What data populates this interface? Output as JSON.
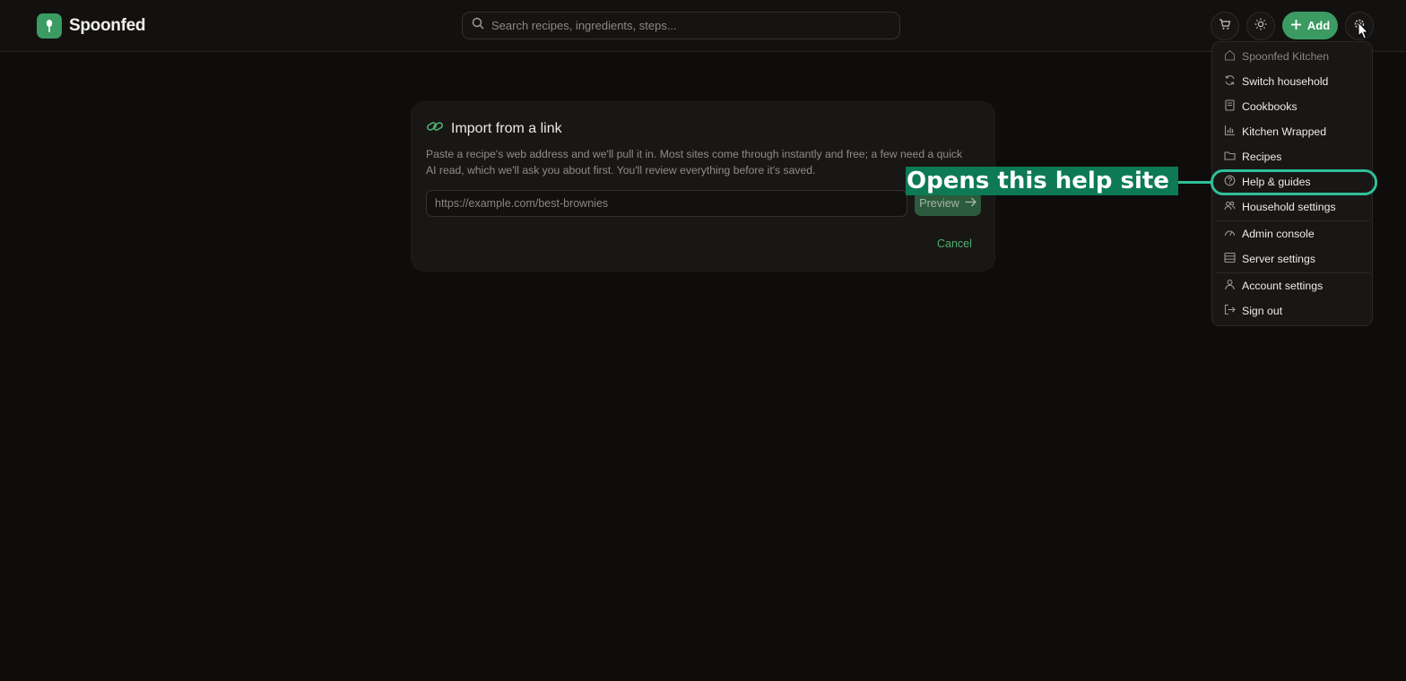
{
  "app": {
    "name": "Spoonfed"
  },
  "header": {
    "search_placeholder": "Search recipes, ingredients, steps...",
    "add_label": "Add"
  },
  "import_card": {
    "title": "Import from a link",
    "description": "Paste a recipe's web address and we'll pull it in. Most sites come through instantly and free; a few need a quick AI read, which we'll ask you about first. You'll review everything before it's saved.",
    "url_placeholder": "https://example.com/best-brownies",
    "preview_label": "Preview",
    "cancel_label": "Cancel"
  },
  "account_menu": {
    "household_name": "Spoonfed Kitchen",
    "items": [
      {
        "label": "Switch household",
        "icon": "refresh-icon"
      },
      {
        "label": "Cookbooks",
        "icon": "book-icon"
      },
      {
        "label": "Kitchen Wrapped",
        "icon": "bar-chart-icon"
      },
      {
        "label": "Recipes",
        "icon": "folder-icon"
      },
      {
        "label": "Help & guides",
        "icon": "help-circle-icon"
      },
      {
        "label": "Household settings",
        "icon": "users-icon"
      },
      {
        "label": "Admin console",
        "icon": "gauge-icon"
      },
      {
        "label": "Server settings",
        "icon": "server-icon"
      },
      {
        "label": "Account settings",
        "icon": "user-icon"
      },
      {
        "label": "Sign out",
        "icon": "sign-out-icon"
      }
    ]
  },
  "annotation": {
    "callout_text": "Opens this help site"
  },
  "colors": {
    "accent": "#3b9b62",
    "callout": "#0d7a55",
    "highlight": "#2fc09a"
  }
}
